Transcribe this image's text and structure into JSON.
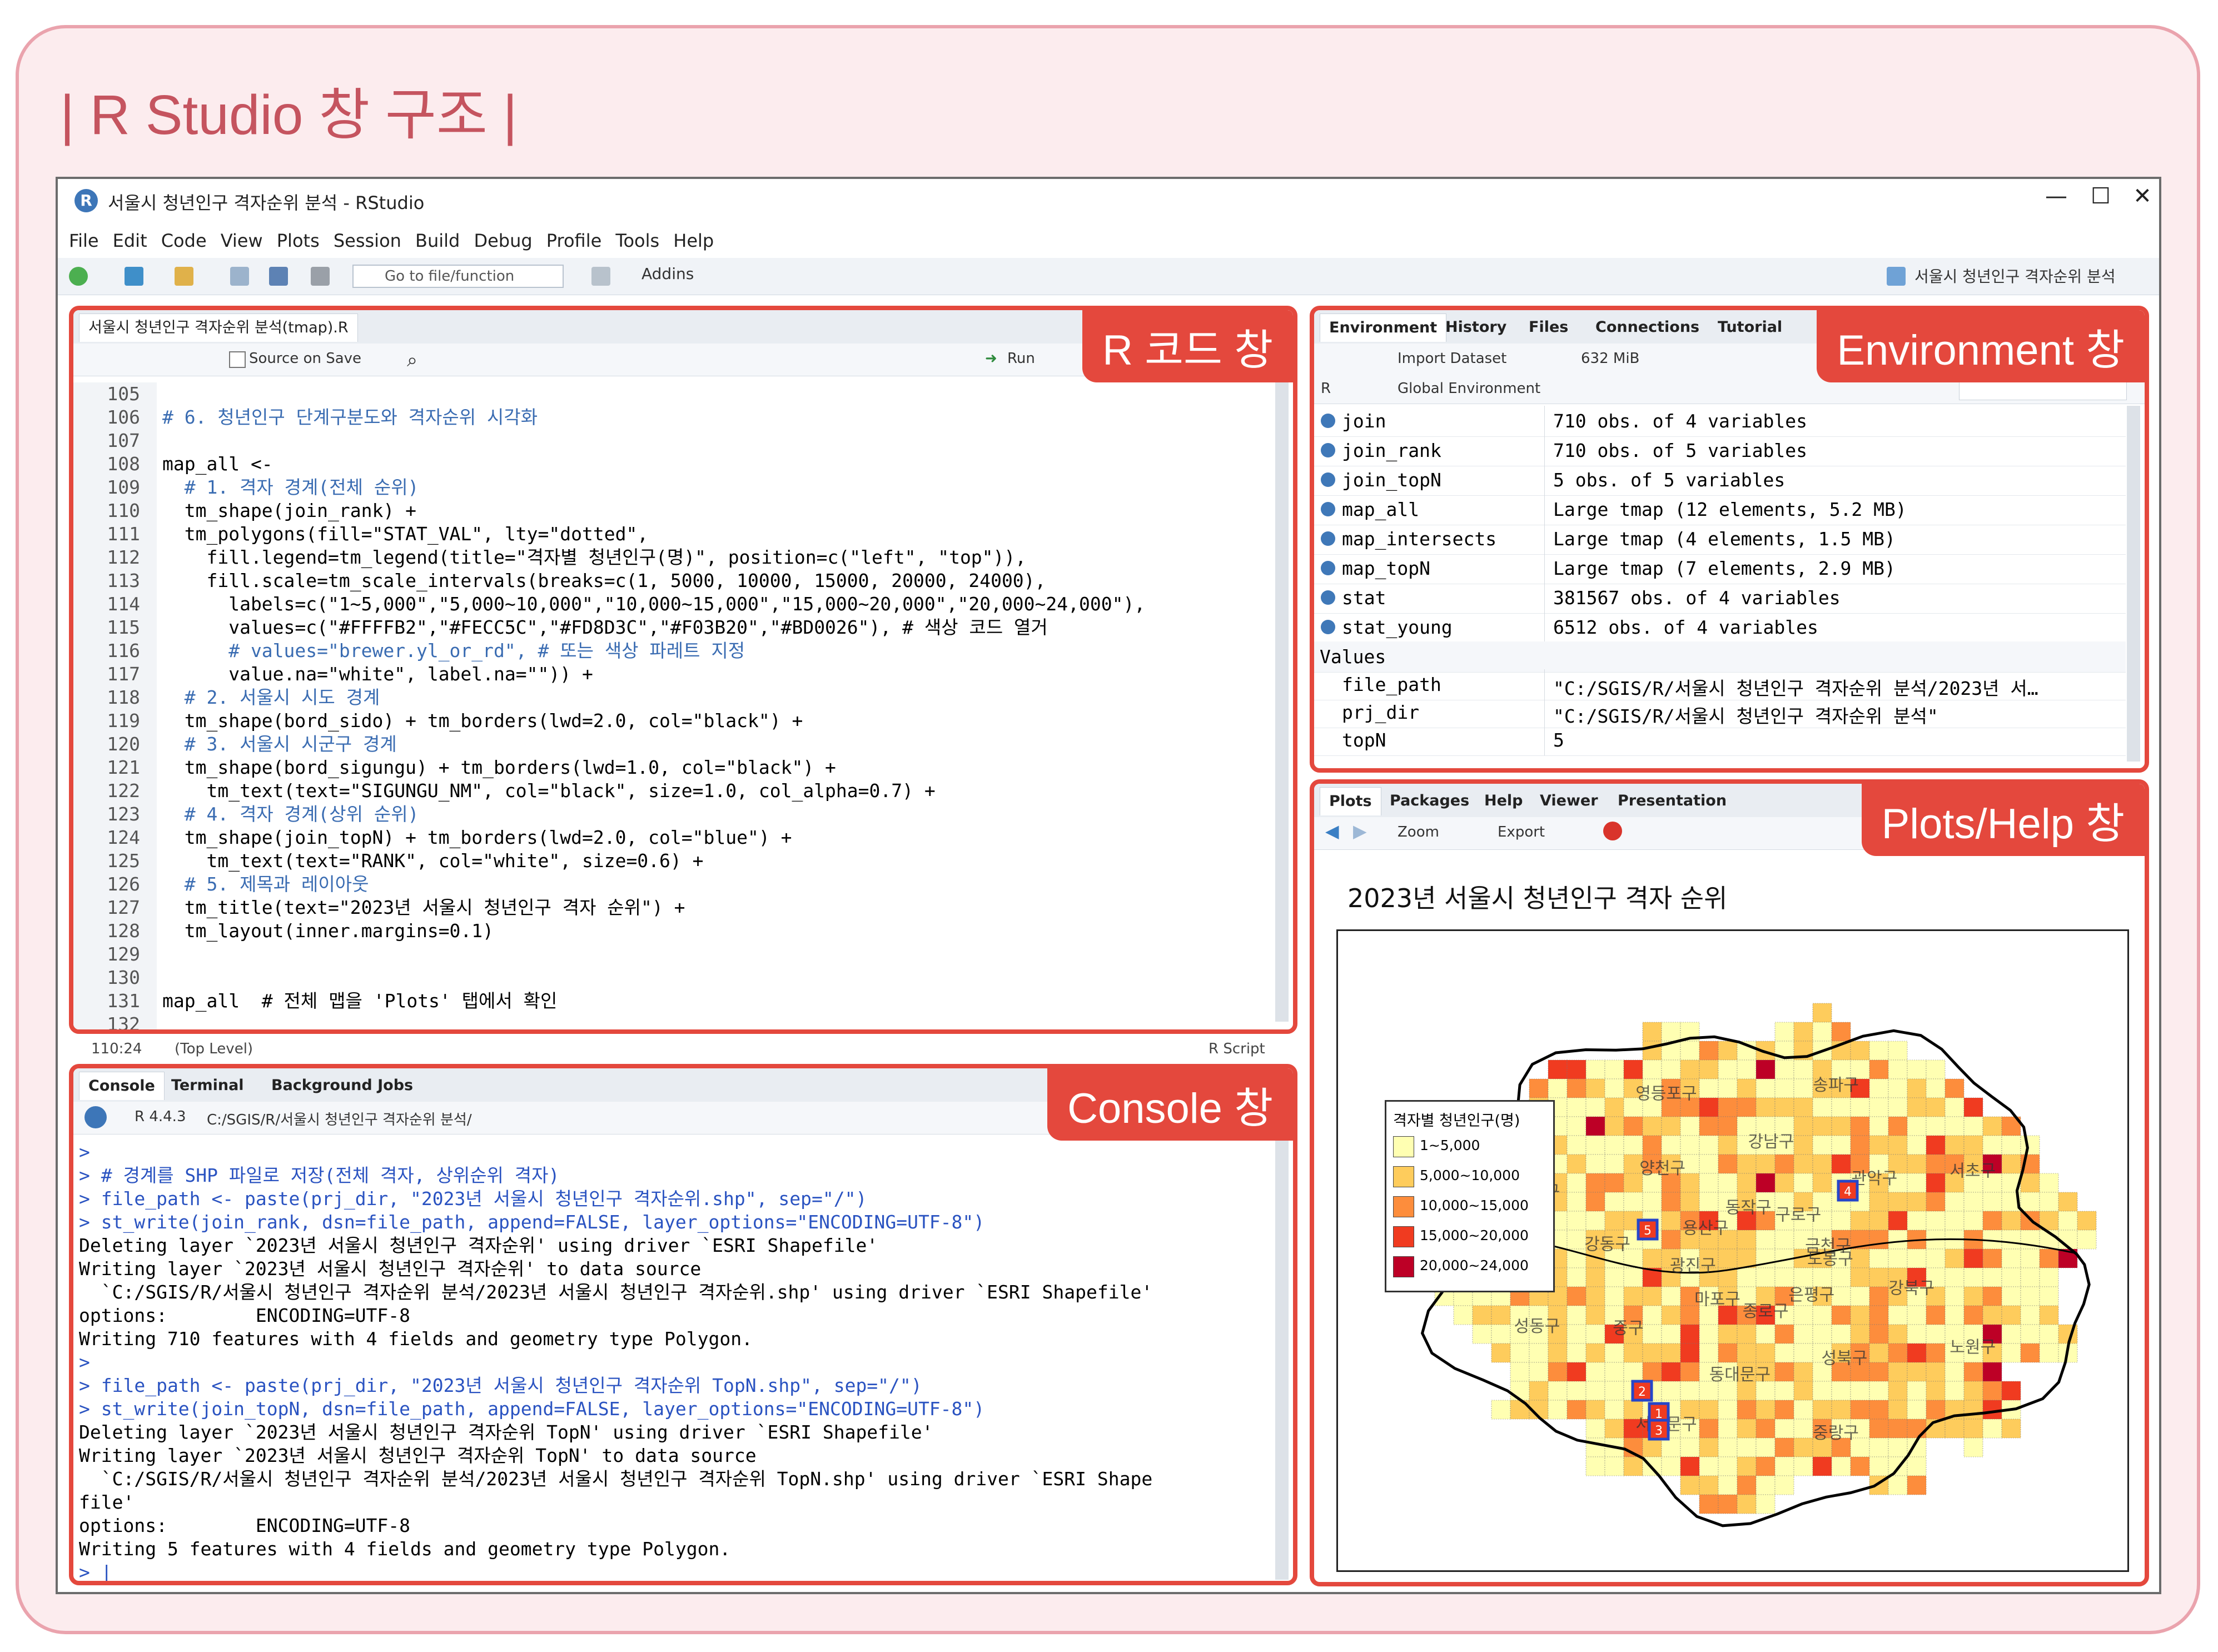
{
  "heading": "| R Studio 창 구조 |",
  "window": {
    "title": "서울시 청년인구 격자순위 분석 - RStudio",
    "logo": "R",
    "controls": [
      "—",
      "☐",
      "✕"
    ]
  },
  "menu": [
    "File",
    "Edit",
    "Code",
    "View",
    "Plots",
    "Session",
    "Build",
    "Debug",
    "Profile",
    "Tools",
    "Help"
  ],
  "toolbar": {
    "goto_placeholder": "Go to file/function",
    "addins": "Addins",
    "project": "서울시 청년인구 격자순위 분석"
  },
  "editor": {
    "tab": "서울시 청년인구 격자순위 분석(tmap).R",
    "source_on_save": "Source on Save",
    "run": "Run",
    "badge": "R 코드 창",
    "status_pos": "110:24",
    "status_level": "(Top Level)",
    "status_type": "R Script",
    "lines": [
      {
        "n": "105",
        "t": ""
      },
      {
        "n": "106",
        "t": "# 6. 청년인구 단계구분도와 격자순위 시각화",
        "c": "cmt"
      },
      {
        "n": "107",
        "t": ""
      },
      {
        "n": "108",
        "t": "map_all <-"
      },
      {
        "n": "109",
        "t": "  # 1. 격자 경계(전체 순위)",
        "c": "cmt"
      },
      {
        "n": "110",
        "t": "  tm_shape(join_rank) +"
      },
      {
        "n": "111",
        "t": "  tm_polygons(fill=\"STAT_VAL\", lty=\"dotted\","
      },
      {
        "n": "112",
        "t": "    fill.legend=tm_legend(title=\"격자별 청년인구(명)\", position=c(\"left\", \"top\")),"
      },
      {
        "n": "113",
        "t": "    fill.scale=tm_scale_intervals(breaks=c(1, 5000, 10000, 15000, 20000, 24000),"
      },
      {
        "n": "114",
        "t": "      labels=c(\"1~5,000\",\"5,000~10,000\",\"10,000~15,000\",\"15,000~20,000\",\"20,000~24,000\"),"
      },
      {
        "n": "115",
        "t": "      values=c(\"#FFFFB2\",\"#FECC5C\",\"#FD8D3C\",\"#F03B20\",\"#BD0026\"), # 색상 코드 열거"
      },
      {
        "n": "116",
        "t": "      # values=\"brewer.yl_or_rd\", # 또는 색상 파레트 지정",
        "c": "cmt"
      },
      {
        "n": "117",
        "t": "      value.na=\"white\", label.na=\"\")) +"
      },
      {
        "n": "118",
        "t": "  # 2. 서울시 시도 경계",
        "c": "cmt"
      },
      {
        "n": "119",
        "t": "  tm_shape(bord_sido) + tm_borders(lwd=2.0, col=\"black\") +"
      },
      {
        "n": "120",
        "t": "  # 3. 서울시 시군구 경계",
        "c": "cmt"
      },
      {
        "n": "121",
        "t": "  tm_shape(bord_sigungu) + tm_borders(lwd=1.0, col=\"black\") +"
      },
      {
        "n": "122",
        "t": "    tm_text(text=\"SIGUNGU_NM\", col=\"black\", size=1.0, col_alpha=0.7) +"
      },
      {
        "n": "123",
        "t": "  # 4. 격자 경계(상위 순위)",
        "c": "cmt"
      },
      {
        "n": "124",
        "t": "  tm_shape(join_topN) + tm_borders(lwd=2.0, col=\"blue\") +"
      },
      {
        "n": "125",
        "t": "    tm_text(text=\"RANK\", col=\"white\", size=0.6) +"
      },
      {
        "n": "126",
        "t": "  # 5. 제목과 레이아웃",
        "c": "cmt"
      },
      {
        "n": "127",
        "t": "  tm_title(text=\"2023년 서울시 청년인구 격자 순위\") +"
      },
      {
        "n": "128",
        "t": "  tm_layout(inner.margins=0.1)"
      },
      {
        "n": "129",
        "t": ""
      },
      {
        "n": "130",
        "t": ""
      },
      {
        "n": "131",
        "t": "map_all  # 전체 맵을 'Plots' 탭에서 확인"
      },
      {
        "n": "132",
        "t": ""
      }
    ]
  },
  "environment": {
    "tabs": [
      "Environment",
      "History",
      "Files",
      "Connections",
      "Tutorial"
    ],
    "badge": "Environment 창",
    "import": "Import Dataset",
    "memory": "632 MiB",
    "lang": "R",
    "scope": "Global Environment",
    "rows": [
      {
        "name": "join",
        "value": "710 obs. of 4 variables"
      },
      {
        "name": "join_rank",
        "value": "710 obs. of 5 variables"
      },
      {
        "name": "join_topN",
        "value": "5 obs. of 5 variables"
      },
      {
        "name": "map_all",
        "value": "Large tmap (12 elements, 5.2 MB)"
      },
      {
        "name": "map_intersects",
        "value": "Large tmap (4 elements, 1.5 MB)"
      },
      {
        "name": "map_topN",
        "value": "Large tmap (7 elements, 2.9 MB)"
      },
      {
        "name": "stat",
        "value": "381567 obs. of 4 variables"
      },
      {
        "name": "stat_young",
        "value": "6512 obs. of 4 variables"
      }
    ],
    "values_header": "Values",
    "values": [
      {
        "name": "file_path",
        "value": "\"C:/SGIS/R/서울시 청년인구 격자순위 분석/2023년 서…"
      },
      {
        "name": "prj_dir",
        "value": "\"C:/SGIS/R/서울시 청년인구 격자순위 분석\""
      },
      {
        "name": "topN",
        "value": "5"
      }
    ]
  },
  "console": {
    "tabs": [
      "Console",
      "Terminal",
      "Background Jobs"
    ],
    "badge": "Console 창",
    "version": "R 4.4.3",
    "path": "C:/SGIS/R/서울시 청년인구 격자순위 분석/",
    "lines": [
      {
        "t": ">",
        "c": "cb"
      },
      {
        "t": "> # 경계를 SHP 파일로 저장(전체 격자, 상위순위 격자)",
        "c": "cb"
      },
      {
        "t": "> file_path <- paste(prj_dir, \"2023년 서울시 청년인구 격자순위.shp\", sep=\"/\")",
        "c": "cb"
      },
      {
        "t": "> st_write(join_rank, dsn=file_path, append=FALSE, layer_options=\"ENCODING=UTF-8\")",
        "c": "cb"
      },
      {
        "t": "Deleting layer `2023년 서울시 청년인구 격자순위' using driver `ESRI Shapefile'",
        "c": "ck"
      },
      {
        "t": "Writing layer `2023년 서울시 청년인구 격자순위' to data source",
        "c": "ck"
      },
      {
        "t": "  `C:/SGIS/R/서울시 청년인구 격자순위 분석/2023년 서울시 청년인구 격자순위.shp' using driver `ESRI Shapefile'",
        "c": "ck"
      },
      {
        "t": "options:        ENCODING=UTF-8",
        "c": "ck"
      },
      {
        "t": "Writing 710 features with 4 fields and geometry type Polygon.",
        "c": "ck"
      },
      {
        "t": ">",
        "c": "cb"
      },
      {
        "t": "> file_path <- paste(prj_dir, \"2023년 서울시 청년인구 격자순위 TopN.shp\", sep=\"/\")",
        "c": "cb"
      },
      {
        "t": "> st_write(join_topN, dsn=file_path, append=FALSE, layer_options=\"ENCODING=UTF-8\")",
        "c": "cb"
      },
      {
        "t": "Deleting layer `2023년 서울시 청년인구 격자순위 TopN' using driver `ESRI Shapefile'",
        "c": "ck"
      },
      {
        "t": "Writing layer `2023년 서울시 청년인구 격자순위 TopN' to data source",
        "c": "ck"
      },
      {
        "t": "  `C:/SGIS/R/서울시 청년인구 격자순위 분석/2023년 서울시 청년인구 격자순위 TopN.shp' using driver `ESRI Shape",
        "c": "ck"
      },
      {
        "t": "file'",
        "c": "ck"
      },
      {
        "t": "options:        ENCODING=UTF-8",
        "c": "ck"
      },
      {
        "t": "Writing 5 features with 4 fields and geometry type Polygon.",
        "c": "ck"
      },
      {
        "t": "> |",
        "c": "cb"
      }
    ]
  },
  "plots": {
    "tabs": [
      "Plots",
      "Packages",
      "Help",
      "Viewer",
      "Presentation"
    ],
    "badge": "Plots/Help 창",
    "zoom": "Zoom",
    "export": "Export",
    "map_title": "2023년 서울시 청년인구 격자 순위",
    "legend_title": "격자별 청년인구(명)",
    "legend": [
      {
        "label": "1~5,000",
        "color": "#FFFFB2"
      },
      {
        "label": "5,000~10,000",
        "color": "#FECC5C"
      },
      {
        "label": "10,000~15,000",
        "color": "#FD8D3C"
      },
      {
        "label": "15,000~20,000",
        "color": "#F03B20"
      },
      {
        "label": "20,000~24,000",
        "color": "#BD0026"
      }
    ],
    "districts": [
      "도봉구",
      "강북구",
      "노원구",
      "은평구",
      "성북구",
      "중랑구",
      "종로구",
      "동대문구",
      "서대문구",
      "마포구",
      "중구",
      "성동구",
      "광진구",
      "강동구",
      "강서구",
      "용산구",
      "양천구",
      "영등포구",
      "동작구",
      "강남구",
      "송파구",
      "구로구",
      "관악구",
      "서초구",
      "금천구"
    ],
    "ranks": [
      "1",
      "2",
      "3",
      "4",
      "5"
    ]
  }
}
